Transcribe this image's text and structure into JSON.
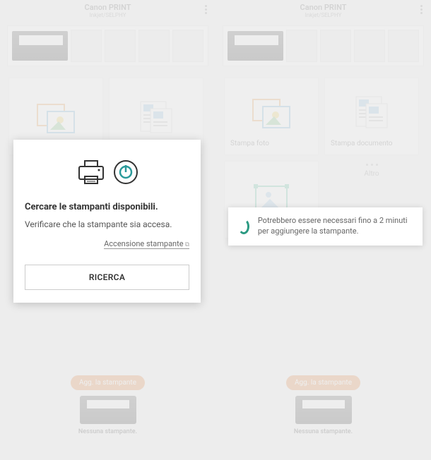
{
  "header": {
    "title": "Canon PRINT",
    "subtitle": "Inkjet/SELPHY"
  },
  "cards": {
    "photo": {
      "label": "Stampa foto"
    },
    "document": {
      "label": "Stampa documento"
    },
    "more_label": "Altro"
  },
  "bottom": {
    "add_button": "Agg. la stampante",
    "no_printer": "Nessuna stampante."
  },
  "modal_search": {
    "title": "Cercare le stampanti disponibili.",
    "subtitle": "Verificare che la stampante sia accesa.",
    "link": "Accensione stampante",
    "button": "RICERCA"
  },
  "modal_wait": {
    "text": "Potrebbero essere necessari fino a 2 minuti per aggiungere la stampante."
  }
}
